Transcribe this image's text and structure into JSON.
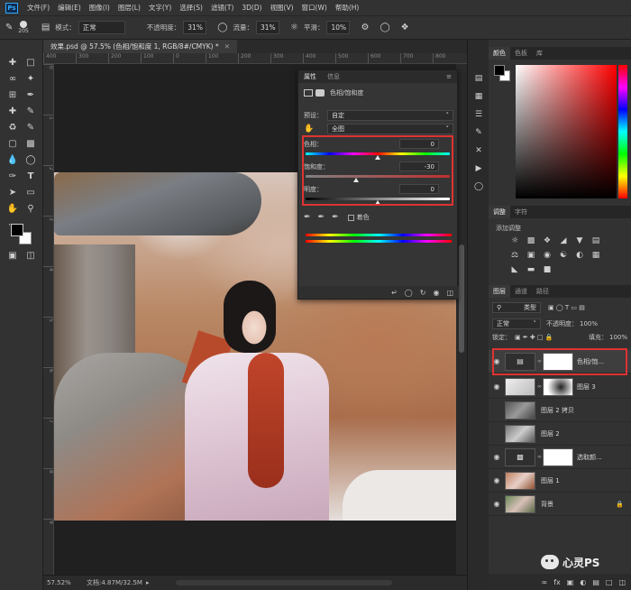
{
  "menu": [
    "文件(F)",
    "编辑(E)",
    "图像(I)",
    "图层(L)",
    "文字(Y)",
    "选择(S)",
    "滤镜(T)",
    "3D(D)",
    "视图(V)",
    "窗口(W)",
    "帮助(H)"
  ],
  "app_logo": "Ps",
  "options": {
    "brush_size": "205",
    "mode_label": "模式：",
    "mode_value": "正常",
    "opacity_label": "不透明度：",
    "opacity_value": "31%",
    "flow_label": "流量：",
    "flow_value": "31%",
    "smooth_label": "平滑：",
    "smooth_value": "10%"
  },
  "document": {
    "tab_title": "效果.psd @ 57.5% (色相/饱和度 1, RGB/8#/CMYK) *",
    "ruler_top": [
      "400",
      "300",
      "200",
      "100",
      "0",
      "100",
      "200",
      "300",
      "400",
      "500",
      "600",
      "700",
      "800"
    ],
    "ruler_left": [
      "0",
      "1",
      "2",
      "3",
      "4",
      "5",
      "6",
      "7",
      "8",
      "9"
    ]
  },
  "properties": {
    "tab_properties": "属性",
    "tab_info": "信息",
    "title": "色相/饱和度",
    "preset_label": "预设：",
    "preset_value": "自定",
    "channel_value": "全图",
    "hue_label": "色相：",
    "hue_value": "0",
    "hue_position": 0.5,
    "saturation_label": "饱和度：",
    "saturation_value": "-30",
    "saturation_position": 0.35,
    "lightness_label": "明度：",
    "lightness_value": "0",
    "lightness_position": 0.5,
    "colorize_label": "着色"
  },
  "panels": {
    "color_tabs": [
      "颜色",
      "色板",
      "库"
    ],
    "adjust_tabs": [
      "调整",
      "字符"
    ],
    "adjust_title": "添加调整",
    "layer_tabs": [
      "图层",
      "通道",
      "路径"
    ],
    "layer_kind": "类型",
    "blend_mode": "正常",
    "opacity_label": "不透明度：",
    "opacity_value": "100%",
    "lock_label": "锁定：",
    "fill_label": "填充：",
    "fill_value": "100%",
    "layers": [
      {
        "name": "色相/饱...",
        "visible": true
      },
      {
        "name": "图层 3",
        "visible": true
      },
      {
        "name": "图层 2 拷贝",
        "visible": false
      },
      {
        "name": "图层 2",
        "visible": false
      },
      {
        "name": "选取颜...",
        "visible": true
      },
      {
        "name": "图层 1",
        "visible": true
      },
      {
        "name": "背景",
        "visible": true
      }
    ]
  },
  "status": {
    "zoom": "57.52%",
    "doc": "文档:4.87M/32.5M"
  },
  "watermark": "心灵PS",
  "colors": {
    "highlight": "#e03232",
    "foreground": "#000000",
    "background": "#ffffff"
  }
}
